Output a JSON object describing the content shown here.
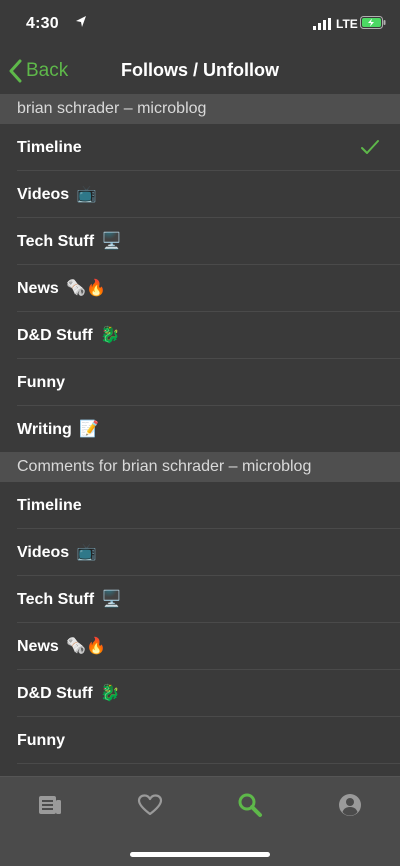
{
  "status": {
    "time": "4:30",
    "network": "LTE"
  },
  "nav": {
    "back_label": "Back",
    "title": "Follows / Unfollow"
  },
  "sections": [
    {
      "header": "brian schrader – microblog",
      "items": [
        {
          "label": "Timeline",
          "emoji": "",
          "checked": true
        },
        {
          "label": "Videos",
          "emoji": "📺"
        },
        {
          "label": "Tech Stuff",
          "emoji": "🖥️"
        },
        {
          "label": "News",
          "emoji": "🗞️🔥"
        },
        {
          "label": "D&D Stuff",
          "emoji": "🐉"
        },
        {
          "label": "Funny",
          "emoji": ""
        },
        {
          "label": "Writing",
          "emoji": "📝"
        }
      ]
    },
    {
      "header": "Comments for brian schrader – microblog",
      "items": [
        {
          "label": "Timeline",
          "emoji": ""
        },
        {
          "label": "Videos",
          "emoji": "📺"
        },
        {
          "label": "Tech Stuff",
          "emoji": "🖥️"
        },
        {
          "label": "News",
          "emoji": "🗞️🔥"
        },
        {
          "label": "D&D Stuff",
          "emoji": "🐉"
        },
        {
          "label": "Funny",
          "emoji": ""
        }
      ]
    }
  ],
  "tabbar": {
    "tabs": [
      {
        "icon": "newspaper-icon"
      },
      {
        "icon": "heart-icon"
      },
      {
        "icon": "search-icon",
        "active": true
      },
      {
        "icon": "profile-icon"
      }
    ]
  },
  "colors": {
    "accent": "#5eb84a",
    "background": "#3a3a3a",
    "section": "#4f4f4f"
  }
}
